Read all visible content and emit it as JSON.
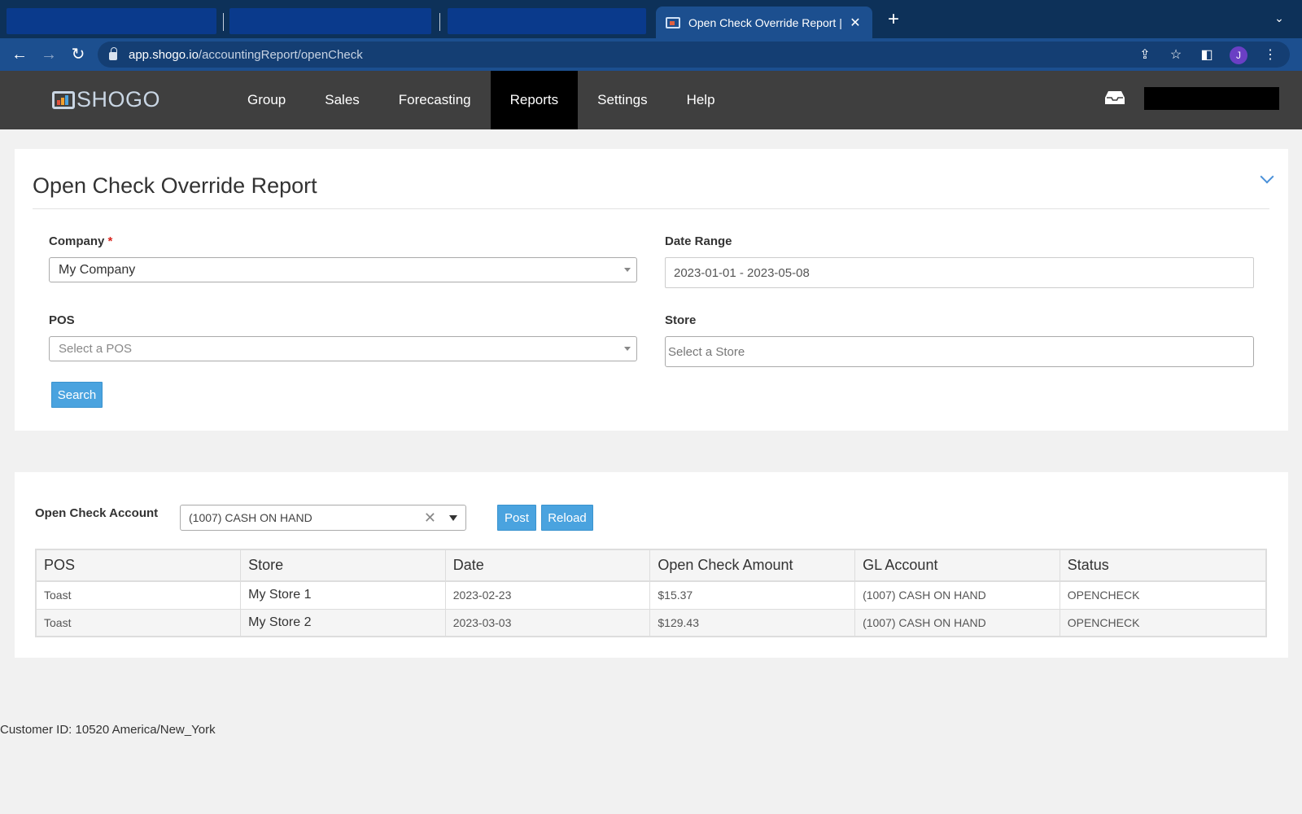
{
  "browser": {
    "active_tab_title": "Open Check Override Report |",
    "url_host": "app.shogo.io",
    "url_path": "/accountingReport/openCheck",
    "profile_initial": "J"
  },
  "app": {
    "logo_text": "SHOGO",
    "nav": [
      {
        "label": "Group"
      },
      {
        "label": "Sales"
      },
      {
        "label": "Forecasting"
      },
      {
        "label": "Reports"
      },
      {
        "label": "Settings"
      },
      {
        "label": "Help"
      }
    ],
    "active_nav": "Reports"
  },
  "filters": {
    "title": "Open Check Override Report",
    "company": {
      "label": "Company",
      "required_mark": "*",
      "value": "My Company"
    },
    "date_range": {
      "label": "Date Range",
      "value": "2023-01-01 - 2023-05-08"
    },
    "pos": {
      "label": "POS",
      "placeholder": "Select a POS"
    },
    "store": {
      "label": "Store",
      "placeholder": "Select a Store"
    },
    "search_label": "Search"
  },
  "results": {
    "account_label": "Open Check Account",
    "account_value": "(1007) CASH ON HAND",
    "post_label": "Post",
    "reload_label": "Reload",
    "columns": [
      "POS",
      "Store",
      "Date",
      "Open Check Amount",
      "GL Account",
      "Status"
    ],
    "rows": [
      [
        "Toast",
        "My Store 1",
        "2023-02-23",
        "$15.37",
        "(1007) CASH ON HAND",
        "OPENCHECK"
      ],
      [
        "Toast",
        "My Store 2",
        "2023-03-03",
        "$129.43",
        "(1007) CASH ON HAND",
        "OPENCHECK"
      ]
    ]
  },
  "footer": {
    "text": "Customer ID: 10520 America/New_York"
  }
}
